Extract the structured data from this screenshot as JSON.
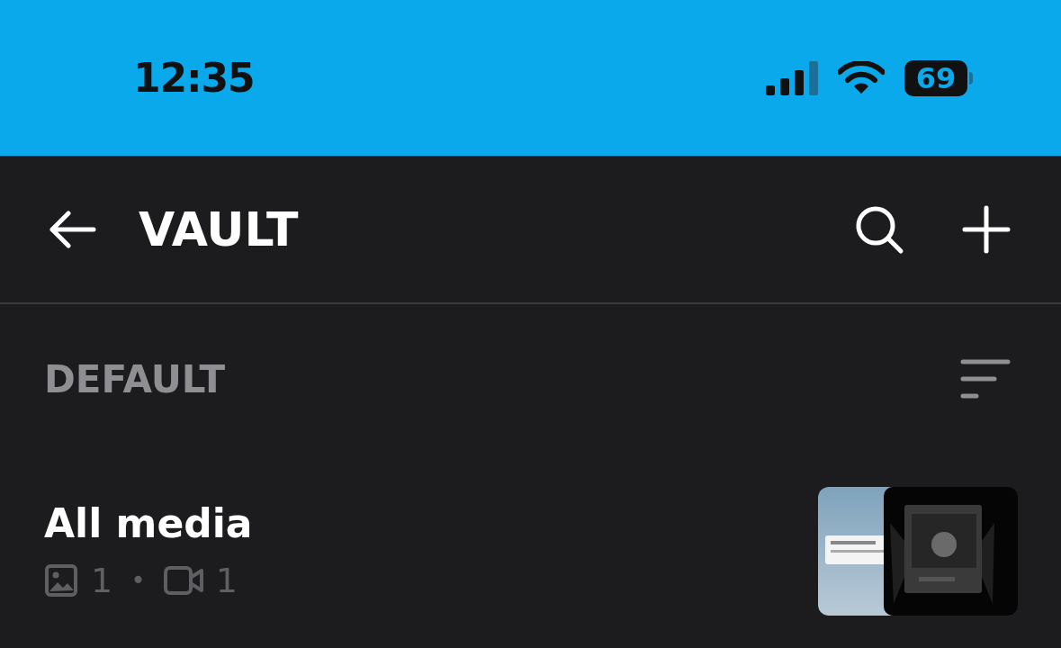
{
  "status_bar": {
    "time": "12:35",
    "battery": "69"
  },
  "header": {
    "title": "VAULT"
  },
  "section": {
    "title": "DEFAULT"
  },
  "lists": [
    {
      "name": "All media",
      "photos": "1",
      "separator": "•",
      "videos": "1"
    }
  ]
}
